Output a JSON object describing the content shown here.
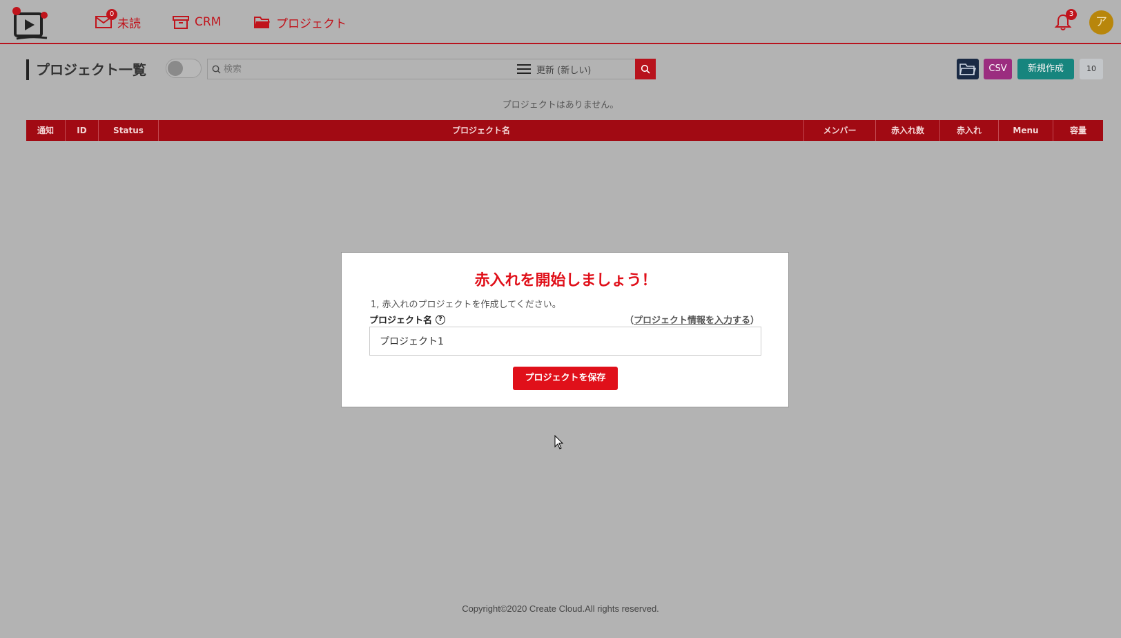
{
  "nav": {
    "unread_label": "未読",
    "unread_count": "0",
    "crm_label": "CRM",
    "project_label": "プロジェクト",
    "notification_count": "3",
    "avatar_initial": "ア"
  },
  "toolbar": {
    "page_title": "プロジェクト一覧",
    "search_placeholder": "検索",
    "sort_label": "更新 (新しい)",
    "csv_label": "CSV",
    "new_label": "新規作成",
    "page_size": "10"
  },
  "empty_message": "プロジェクトはありません。",
  "table": {
    "columns": [
      "通知",
      "ID",
      "Status",
      "プロジェクト名",
      "メンバー",
      "赤入れ数",
      "赤入れ",
      "Menu",
      "容量"
    ]
  },
  "modal": {
    "title": "赤入れを開始しましょう！",
    "step": "1, 赤入れのプロジェクトを作成してください。",
    "label": "プロジェクト名",
    "help_symbol": "?",
    "link_open": "（",
    "link_text": "プロジェクト情報を入力する",
    "link_close": "）",
    "input_value": "プロジェクト1",
    "save_label": "プロジェクトを保存"
  },
  "footer": "Copyright©2020 Create Cloud.All rights reserved.",
  "colors": {
    "accent": "#b8131d",
    "table_header": "#a10a13",
    "csv": "#9b2d7f",
    "new": "#17857e",
    "folder": "#1a2a44"
  }
}
